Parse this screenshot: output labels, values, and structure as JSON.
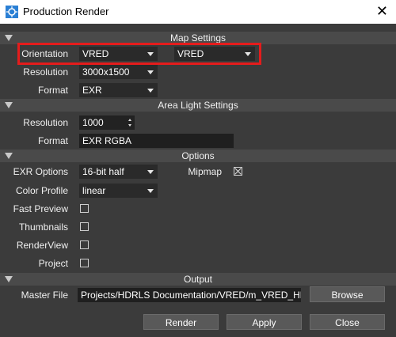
{
  "window": {
    "title": "Production Render"
  },
  "sections": {
    "map_settings": "Map Settings",
    "area_light_settings": "Area Light Settings",
    "options": "Options",
    "output": "Output"
  },
  "map_settings": {
    "orientation_label": "Orientation",
    "orientation_value_1": "VRED",
    "orientation_value_2": "VRED",
    "resolution_label": "Resolution",
    "resolution_value": "3000x1500",
    "format_label": "Format",
    "format_value": "EXR"
  },
  "area_light_settings": {
    "resolution_label": "Resolution",
    "resolution_value": "1000",
    "format_label": "Format",
    "format_value": "EXR RGBA"
  },
  "options": {
    "exr_options_label": "EXR Options",
    "exr_options_value": "16-bit half",
    "mipmap_label": "Mipmap",
    "mipmap_checked": true,
    "color_profile_label": "Color Profile",
    "color_profile_value": "linear",
    "fast_preview_label": "Fast Preview",
    "thumbnails_label": "Thumbnails",
    "renderview_label": "RenderView",
    "project_label": "Project"
  },
  "output": {
    "master_file_label": "Master File",
    "master_file_value": "Projects/HDRLS Documentation/VRED/m_VRED_HDRI.exr",
    "browse_label": "Browse"
  },
  "buttons": {
    "render": "Render",
    "apply": "Apply",
    "close": "Close"
  },
  "colors": {
    "highlight": "#e51c1c",
    "background": "#3b3b3b",
    "header": "#4a4a4a"
  }
}
